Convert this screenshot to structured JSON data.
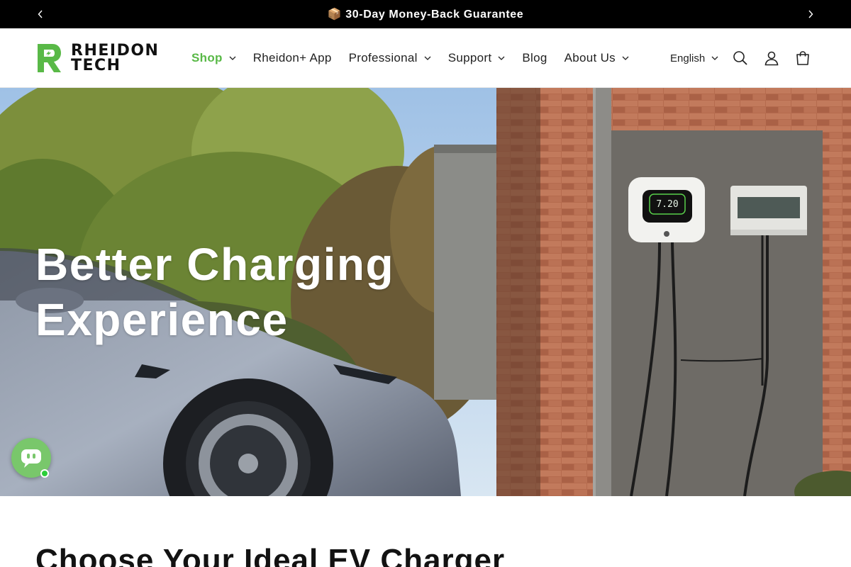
{
  "announcement": {
    "text": "📦 30-Day Money-Back Guarantee",
    "prev_icon": "chevron-left-icon",
    "next_icon": "chevron-right-icon"
  },
  "header": {
    "logo": {
      "line1": "RHEIDON",
      "line2": "TECH",
      "accent": "#59b947"
    },
    "nav": [
      {
        "label": "Shop",
        "has_dropdown": true,
        "active": true
      },
      {
        "label": "Rheidon+ App",
        "has_dropdown": false
      },
      {
        "label": "Professional",
        "has_dropdown": true
      },
      {
        "label": "Support",
        "has_dropdown": true
      },
      {
        "label": "Blog",
        "has_dropdown": false
      },
      {
        "label": "About Us",
        "has_dropdown": true
      }
    ],
    "language": "English",
    "icons": [
      "search-icon",
      "account-icon",
      "cart-icon"
    ]
  },
  "hero": {
    "title_line1": "Better Charging",
    "title_line2": "Experience",
    "charger_display": "7.20"
  },
  "chat_widget": {
    "icon": "chat-bubble-icon",
    "status": "online",
    "color": "#79c76b"
  },
  "section": {
    "title": "Choose Your Ideal EV Charger"
  },
  "colors": {
    "brand_green": "#59b947",
    "announcement_bg": "#000000",
    "text": "#121212"
  }
}
